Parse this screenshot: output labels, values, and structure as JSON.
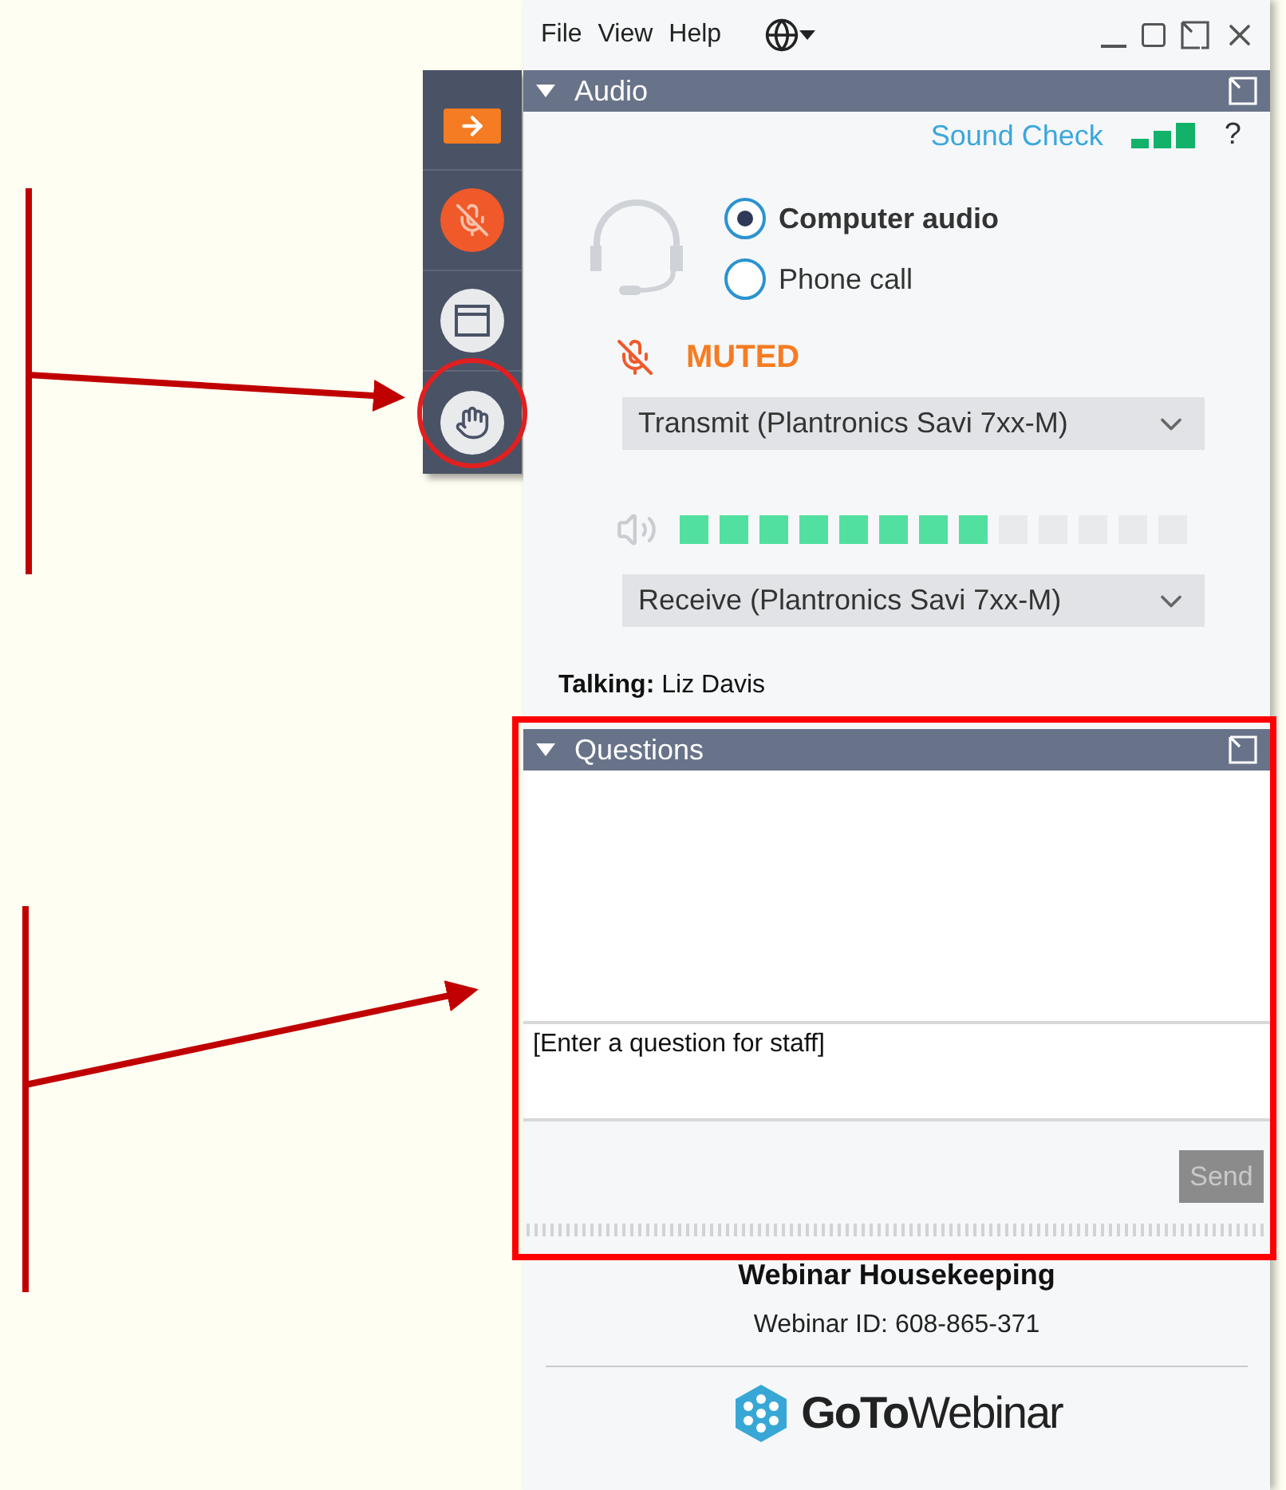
{
  "menu": [
    "File",
    "View",
    "Help"
  ],
  "audio": {
    "title": "Audio",
    "sound_check": "Sound Check",
    "help": "?",
    "options": [
      {
        "label": "Computer audio",
        "selected": true
      },
      {
        "label": "Phone call",
        "selected": false
      }
    ],
    "mute_status": "MUTED",
    "transmit": "Transmit (Plantronics Savi 7xx-M)",
    "level": 0.615,
    "receive": "Receive (Plantronics Savi 7xx-M)",
    "talking_label": "Talking:",
    "talking_name": "Liz Davis"
  },
  "questions": {
    "title": "Questions",
    "placeholder": "[Enter a question for staff]",
    "send": {
      "label": "Send",
      "disabled": true
    }
  },
  "footer": {
    "title": "Webinar Housekeeping",
    "webinar_id": "Webinar ID: 608-865-371",
    "logo_bold": "GoTo",
    "logo_light": "Webinar"
  }
}
